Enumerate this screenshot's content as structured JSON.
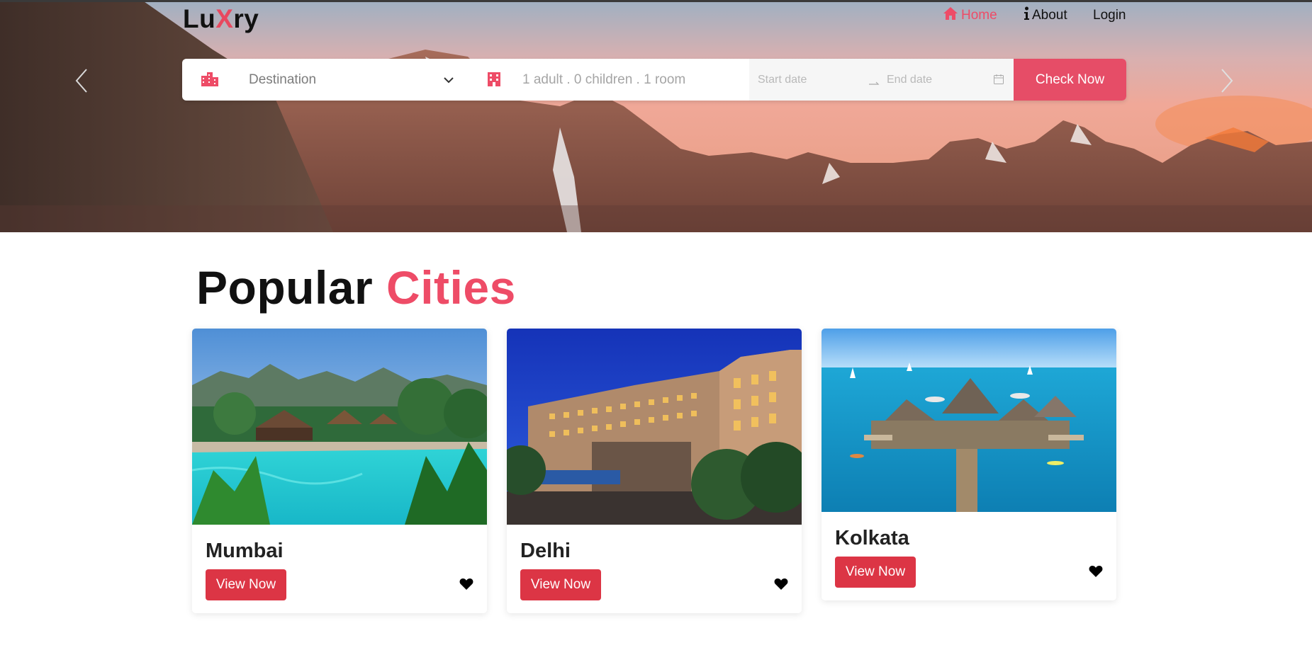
{
  "brand": {
    "logo_prefix": "Lu",
    "logo_x": "X",
    "logo_suffix": "ry",
    "accent_color": "#ee4c67"
  },
  "nav": {
    "home": {
      "label": "Home",
      "icon": "home-icon"
    },
    "about": {
      "label": "About",
      "icon": "info-icon"
    },
    "login": {
      "label": "Login"
    }
  },
  "search": {
    "destination_placeholder": "Destination",
    "guests_text": "1 adult . 0 children . 1 room",
    "start_date_placeholder": "Start date",
    "end_date_placeholder": "End date",
    "submit_label": "Check Now"
  },
  "section": {
    "title_main": "Popular",
    "title_accent": "Cities"
  },
  "cities": [
    {
      "name": "Mumbai",
      "button_label": "View Now"
    },
    {
      "name": "Delhi",
      "button_label": "View Now"
    },
    {
      "name": "Kolkata",
      "button_label": "View Now"
    }
  ],
  "colors": {
    "button_red": "#dc3545",
    "check_now": "#e64d67",
    "text_dark": "#111111"
  }
}
